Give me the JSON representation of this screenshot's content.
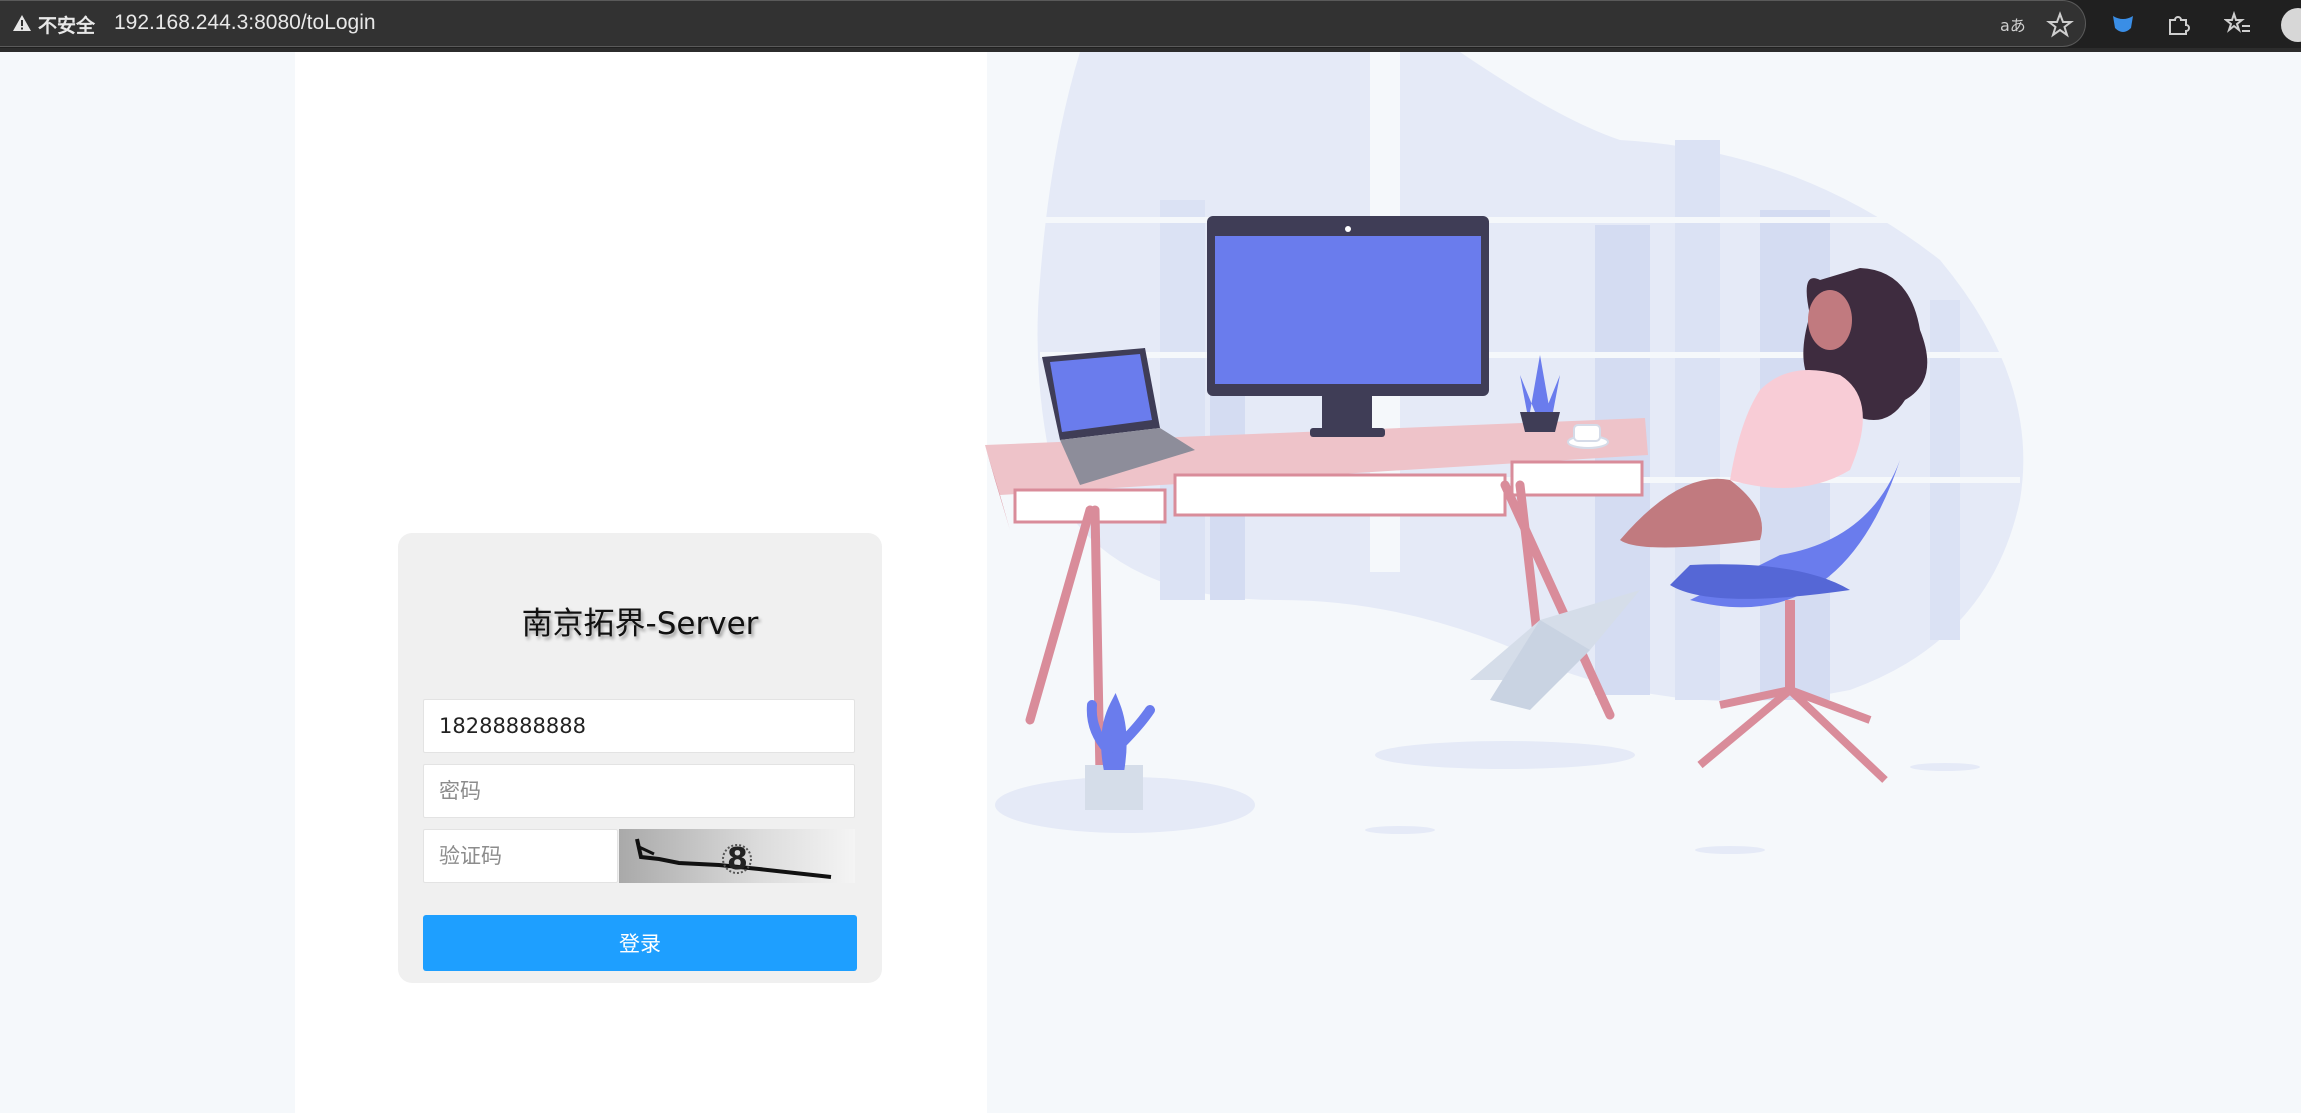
{
  "browser": {
    "security_label": "不安全",
    "url": "192.168.244.3:8080/toLogin",
    "icons": [
      "warning-icon",
      "read-aloud-icon",
      "favorite-star-icon",
      "extension-bird-icon",
      "extensions-puzzle-icon",
      "favorites-list-icon",
      "profile-avatar"
    ]
  },
  "login": {
    "title": "南京拓界-Server",
    "username_value": "18288888888",
    "password_placeholder": "密码",
    "captcha_placeholder": "验证码",
    "submit_label": "登录"
  },
  "colors": {
    "primary_button": "#1e9fff",
    "card_bg": "#f0f0f0",
    "page_bg": "#f5f8fb",
    "monitor_screen": "#6a7ced",
    "desk": "#eec3c9"
  }
}
